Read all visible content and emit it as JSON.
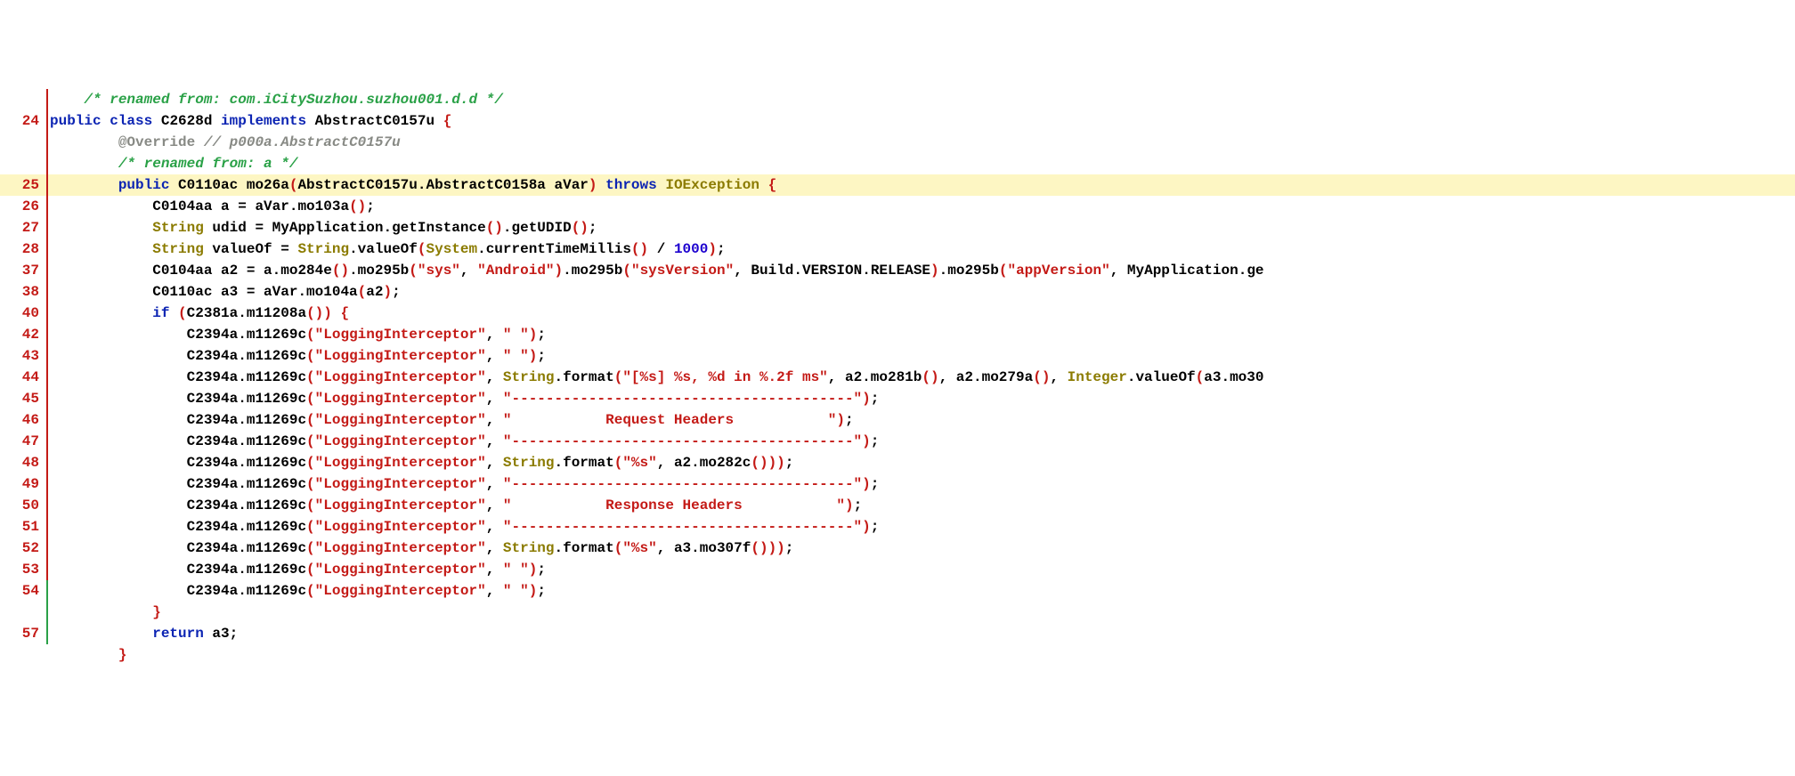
{
  "lines": [
    {
      "num": "",
      "vbar": "red",
      "hl": false,
      "indent": "    ",
      "tokens": [
        {
          "cls": "c-comment",
          "t": "/* renamed from: com.iCitySuzhou.suzhou001.d.d */"
        }
      ]
    },
    {
      "num": "24",
      "vbar": "red",
      "hl": false,
      "indent": "",
      "tokens": [
        {
          "cls": "c-keyword",
          "t": "public"
        },
        {
          "cls": "",
          "t": " "
        },
        {
          "cls": "c-keyword",
          "t": "class"
        },
        {
          "cls": "",
          "t": " C2628d "
        },
        {
          "cls": "c-keyword",
          "t": "implements"
        },
        {
          "cls": "",
          "t": " AbstractC0157u "
        },
        {
          "cls": "c-brace",
          "t": "{"
        }
      ]
    },
    {
      "num": "",
      "vbar": "red",
      "hl": false,
      "indent": "        ",
      "tokens": [
        {
          "cls": "c-annot",
          "t": "@Override"
        },
        {
          "cls": "",
          "t": " "
        },
        {
          "cls": "c-annot-comment",
          "t": "// p000a.AbstractC0157u"
        }
      ]
    },
    {
      "num": "",
      "vbar": "red",
      "hl": false,
      "indent": "        ",
      "tokens": [
        {
          "cls": "c-comment",
          "t": "/* renamed from: a */"
        }
      ]
    },
    {
      "num": "25",
      "vbar": "red",
      "hl": true,
      "indent": "        ",
      "tokens": [
        {
          "cls": "c-keyword",
          "t": "public"
        },
        {
          "cls": "",
          "t": " C0110ac mo26a"
        },
        {
          "cls": "c-paren",
          "t": "("
        },
        {
          "cls": "",
          "t": "AbstractC0157u.AbstractC0158a aVar"
        },
        {
          "cls": "c-paren",
          "t": ")"
        },
        {
          "cls": "",
          "t": " "
        },
        {
          "cls": "c-keyword",
          "t": "throws"
        },
        {
          "cls": "",
          "t": " "
        },
        {
          "cls": "c-throws",
          "t": "IOException"
        },
        {
          "cls": "",
          "t": " "
        },
        {
          "cls": "c-brace",
          "t": "{"
        }
      ]
    },
    {
      "num": "26",
      "vbar": "red",
      "hl": false,
      "indent": "            ",
      "tokens": [
        {
          "cls": "",
          "t": "C0104aa a = aVar.mo103a"
        },
        {
          "cls": "c-paren",
          "t": "()"
        },
        {
          "cls": "",
          "t": ";"
        }
      ]
    },
    {
      "num": "27",
      "vbar": "red",
      "hl": false,
      "indent": "            ",
      "tokens": [
        {
          "cls": "c-type",
          "t": "String"
        },
        {
          "cls": "",
          "t": " udid = MyApplication.getInstance"
        },
        {
          "cls": "c-paren",
          "t": "()"
        },
        {
          "cls": "",
          "t": ".getUDID"
        },
        {
          "cls": "c-paren",
          "t": "()"
        },
        {
          "cls": "",
          "t": ";"
        }
      ]
    },
    {
      "num": "28",
      "vbar": "red",
      "hl": false,
      "indent": "            ",
      "tokens": [
        {
          "cls": "c-type",
          "t": "String"
        },
        {
          "cls": "",
          "t": " valueOf = "
        },
        {
          "cls": "c-type",
          "t": "String"
        },
        {
          "cls": "",
          "t": ".valueOf"
        },
        {
          "cls": "c-paren",
          "t": "("
        },
        {
          "cls": "c-type",
          "t": "System"
        },
        {
          "cls": "",
          "t": ".currentTimeMillis"
        },
        {
          "cls": "c-paren",
          "t": "()"
        },
        {
          "cls": "",
          "t": " / "
        },
        {
          "cls": "c-number",
          "t": "1000"
        },
        {
          "cls": "c-paren",
          "t": ")"
        },
        {
          "cls": "",
          "t": ";"
        }
      ]
    },
    {
      "num": "37",
      "vbar": "red",
      "hl": false,
      "indent": "            ",
      "tokens": [
        {
          "cls": "",
          "t": "C0104aa a2 = a.mo284e"
        },
        {
          "cls": "c-paren",
          "t": "()"
        },
        {
          "cls": "",
          "t": ".mo295b"
        },
        {
          "cls": "c-paren",
          "t": "("
        },
        {
          "cls": "c-string",
          "t": "\"sys\""
        },
        {
          "cls": "",
          "t": ", "
        },
        {
          "cls": "c-string",
          "t": "\"Android\""
        },
        {
          "cls": "c-paren",
          "t": ")"
        },
        {
          "cls": "",
          "t": ".mo295b"
        },
        {
          "cls": "c-paren",
          "t": "("
        },
        {
          "cls": "c-string",
          "t": "\"sysVersion\""
        },
        {
          "cls": "",
          "t": ", Build.VERSION.RELEASE"
        },
        {
          "cls": "c-paren",
          "t": ")"
        },
        {
          "cls": "",
          "t": ".mo295b"
        },
        {
          "cls": "c-paren",
          "t": "("
        },
        {
          "cls": "c-string",
          "t": "\"appVersion\""
        },
        {
          "cls": "",
          "t": ", MyApplication.ge"
        }
      ]
    },
    {
      "num": "38",
      "vbar": "red",
      "hl": false,
      "indent": "            ",
      "tokens": [
        {
          "cls": "",
          "t": "C0110ac a3 = aVar.mo104a"
        },
        {
          "cls": "c-paren",
          "t": "("
        },
        {
          "cls": "",
          "t": "a2"
        },
        {
          "cls": "c-paren",
          "t": ")"
        },
        {
          "cls": "",
          "t": ";"
        }
      ]
    },
    {
      "num": "40",
      "vbar": "red",
      "hl": false,
      "indent": "            ",
      "tokens": [
        {
          "cls": "c-keyword",
          "t": "if"
        },
        {
          "cls": "",
          "t": " "
        },
        {
          "cls": "c-paren",
          "t": "("
        },
        {
          "cls": "",
          "t": "C2381a.m11208a"
        },
        {
          "cls": "c-paren",
          "t": "())"
        },
        {
          "cls": "",
          "t": " "
        },
        {
          "cls": "c-brace",
          "t": "{"
        }
      ]
    },
    {
      "num": "42",
      "vbar": "red",
      "hl": false,
      "indent": "                ",
      "tokens": [
        {
          "cls": "",
          "t": "C2394a.m11269c"
        },
        {
          "cls": "c-paren",
          "t": "("
        },
        {
          "cls": "c-string",
          "t": "\"LoggingInterceptor\""
        },
        {
          "cls": "",
          "t": ", "
        },
        {
          "cls": "c-string",
          "t": "\" \""
        },
        {
          "cls": "c-paren",
          "t": ")"
        },
        {
          "cls": "",
          "t": ";"
        }
      ]
    },
    {
      "num": "43",
      "vbar": "red",
      "hl": false,
      "indent": "                ",
      "tokens": [
        {
          "cls": "",
          "t": "C2394a.m11269c"
        },
        {
          "cls": "c-paren",
          "t": "("
        },
        {
          "cls": "c-string",
          "t": "\"LoggingInterceptor\""
        },
        {
          "cls": "",
          "t": ", "
        },
        {
          "cls": "c-string",
          "t": "\" \""
        },
        {
          "cls": "c-paren",
          "t": ")"
        },
        {
          "cls": "",
          "t": ";"
        }
      ]
    },
    {
      "num": "44",
      "vbar": "red",
      "hl": false,
      "indent": "                ",
      "tokens": [
        {
          "cls": "",
          "t": "C2394a.m11269c"
        },
        {
          "cls": "c-paren",
          "t": "("
        },
        {
          "cls": "c-string",
          "t": "\"LoggingInterceptor\""
        },
        {
          "cls": "",
          "t": ", "
        },
        {
          "cls": "c-type",
          "t": "String"
        },
        {
          "cls": "",
          "t": ".format"
        },
        {
          "cls": "c-paren",
          "t": "("
        },
        {
          "cls": "c-string",
          "t": "\"[%s] %s, %d in %.2f ms\""
        },
        {
          "cls": "",
          "t": ", a2.mo281b"
        },
        {
          "cls": "c-paren",
          "t": "()"
        },
        {
          "cls": "",
          "t": ", a2.mo279a"
        },
        {
          "cls": "c-paren",
          "t": "()"
        },
        {
          "cls": "",
          "t": ", "
        },
        {
          "cls": "c-type",
          "t": "Integer"
        },
        {
          "cls": "",
          "t": ".valueOf"
        },
        {
          "cls": "c-paren",
          "t": "("
        },
        {
          "cls": "",
          "t": "a3.mo30"
        }
      ]
    },
    {
      "num": "45",
      "vbar": "red",
      "hl": false,
      "indent": "                ",
      "tokens": [
        {
          "cls": "",
          "t": "C2394a.m11269c"
        },
        {
          "cls": "c-paren",
          "t": "("
        },
        {
          "cls": "c-string",
          "t": "\"LoggingInterceptor\""
        },
        {
          "cls": "",
          "t": ", "
        },
        {
          "cls": "c-string",
          "t": "\"----------------------------------------\""
        },
        {
          "cls": "c-paren",
          "t": ")"
        },
        {
          "cls": "",
          "t": ";"
        }
      ]
    },
    {
      "num": "46",
      "vbar": "red",
      "hl": false,
      "indent": "                ",
      "tokens": [
        {
          "cls": "",
          "t": "C2394a.m11269c"
        },
        {
          "cls": "c-paren",
          "t": "("
        },
        {
          "cls": "c-string",
          "t": "\"LoggingInterceptor\""
        },
        {
          "cls": "",
          "t": ", "
        },
        {
          "cls": "c-string",
          "t": "\"           Request Headers           \""
        },
        {
          "cls": "c-paren",
          "t": ")"
        },
        {
          "cls": "",
          "t": ";"
        }
      ]
    },
    {
      "num": "47",
      "vbar": "red",
      "hl": false,
      "indent": "                ",
      "tokens": [
        {
          "cls": "",
          "t": "C2394a.m11269c"
        },
        {
          "cls": "c-paren",
          "t": "("
        },
        {
          "cls": "c-string",
          "t": "\"LoggingInterceptor\""
        },
        {
          "cls": "",
          "t": ", "
        },
        {
          "cls": "c-string",
          "t": "\"----------------------------------------\""
        },
        {
          "cls": "c-paren",
          "t": ")"
        },
        {
          "cls": "",
          "t": ";"
        }
      ]
    },
    {
      "num": "48",
      "vbar": "red",
      "hl": false,
      "indent": "                ",
      "tokens": [
        {
          "cls": "",
          "t": "C2394a.m11269c"
        },
        {
          "cls": "c-paren",
          "t": "("
        },
        {
          "cls": "c-string",
          "t": "\"LoggingInterceptor\""
        },
        {
          "cls": "",
          "t": ", "
        },
        {
          "cls": "c-type",
          "t": "String"
        },
        {
          "cls": "",
          "t": ".format"
        },
        {
          "cls": "c-paren",
          "t": "("
        },
        {
          "cls": "c-string",
          "t": "\"%s\""
        },
        {
          "cls": "",
          "t": ", a2.mo282c"
        },
        {
          "cls": "c-paren",
          "t": "()))"
        },
        {
          "cls": "",
          "t": ";"
        }
      ]
    },
    {
      "num": "49",
      "vbar": "red",
      "hl": false,
      "indent": "                ",
      "tokens": [
        {
          "cls": "",
          "t": "C2394a.m11269c"
        },
        {
          "cls": "c-paren",
          "t": "("
        },
        {
          "cls": "c-string",
          "t": "\"LoggingInterceptor\""
        },
        {
          "cls": "",
          "t": ", "
        },
        {
          "cls": "c-string",
          "t": "\"----------------------------------------\""
        },
        {
          "cls": "c-paren",
          "t": ")"
        },
        {
          "cls": "",
          "t": ";"
        }
      ]
    },
    {
      "num": "50",
      "vbar": "red",
      "hl": false,
      "indent": "                ",
      "tokens": [
        {
          "cls": "",
          "t": "C2394a.m11269c"
        },
        {
          "cls": "c-paren",
          "t": "("
        },
        {
          "cls": "c-string",
          "t": "\"LoggingInterceptor\""
        },
        {
          "cls": "",
          "t": ", "
        },
        {
          "cls": "c-string",
          "t": "\"           Response Headers           \""
        },
        {
          "cls": "c-paren",
          "t": ")"
        },
        {
          "cls": "",
          "t": ";"
        }
      ]
    },
    {
      "num": "51",
      "vbar": "red",
      "hl": false,
      "indent": "                ",
      "tokens": [
        {
          "cls": "",
          "t": "C2394a.m11269c"
        },
        {
          "cls": "c-paren",
          "t": "("
        },
        {
          "cls": "c-string",
          "t": "\"LoggingInterceptor\""
        },
        {
          "cls": "",
          "t": ", "
        },
        {
          "cls": "c-string",
          "t": "\"----------------------------------------\""
        },
        {
          "cls": "c-paren",
          "t": ")"
        },
        {
          "cls": "",
          "t": ";"
        }
      ]
    },
    {
      "num": "52",
      "vbar": "red",
      "hl": false,
      "indent": "                ",
      "tokens": [
        {
          "cls": "",
          "t": "C2394a.m11269c"
        },
        {
          "cls": "c-paren",
          "t": "("
        },
        {
          "cls": "c-string",
          "t": "\"LoggingInterceptor\""
        },
        {
          "cls": "",
          "t": ", "
        },
        {
          "cls": "c-type",
          "t": "String"
        },
        {
          "cls": "",
          "t": ".format"
        },
        {
          "cls": "c-paren",
          "t": "("
        },
        {
          "cls": "c-string",
          "t": "\"%s\""
        },
        {
          "cls": "",
          "t": ", a3.mo307f"
        },
        {
          "cls": "c-paren",
          "t": "()))"
        },
        {
          "cls": "",
          "t": ";"
        }
      ]
    },
    {
      "num": "53",
      "vbar": "red",
      "hl": false,
      "indent": "                ",
      "tokens": [
        {
          "cls": "",
          "t": "C2394a.m11269c"
        },
        {
          "cls": "c-paren",
          "t": "("
        },
        {
          "cls": "c-string",
          "t": "\"LoggingInterceptor\""
        },
        {
          "cls": "",
          "t": ", "
        },
        {
          "cls": "c-string",
          "t": "\" \""
        },
        {
          "cls": "c-paren",
          "t": ")"
        },
        {
          "cls": "",
          "t": ";"
        }
      ]
    },
    {
      "num": "54",
      "vbar": "green",
      "hl": false,
      "indent": "                ",
      "tokens": [
        {
          "cls": "",
          "t": "C2394a.m11269c"
        },
        {
          "cls": "c-paren",
          "t": "("
        },
        {
          "cls": "c-string",
          "t": "\"LoggingInterceptor\""
        },
        {
          "cls": "",
          "t": ", "
        },
        {
          "cls": "c-string",
          "t": "\" \""
        },
        {
          "cls": "c-paren",
          "t": ")"
        },
        {
          "cls": "",
          "t": ";"
        }
      ]
    },
    {
      "num": "",
      "vbar": "green",
      "hl": false,
      "indent": "            ",
      "tokens": [
        {
          "cls": "c-brace",
          "t": "}"
        }
      ]
    },
    {
      "num": "57",
      "vbar": "green",
      "hl": false,
      "indent": "            ",
      "tokens": [
        {
          "cls": "c-keyword",
          "t": "return"
        },
        {
          "cls": "",
          "t": " a3;"
        }
      ]
    },
    {
      "num": "",
      "vbar": "",
      "hl": false,
      "indent": "        ",
      "tokens": [
        {
          "cls": "c-brace",
          "t": "}"
        }
      ]
    }
  ]
}
